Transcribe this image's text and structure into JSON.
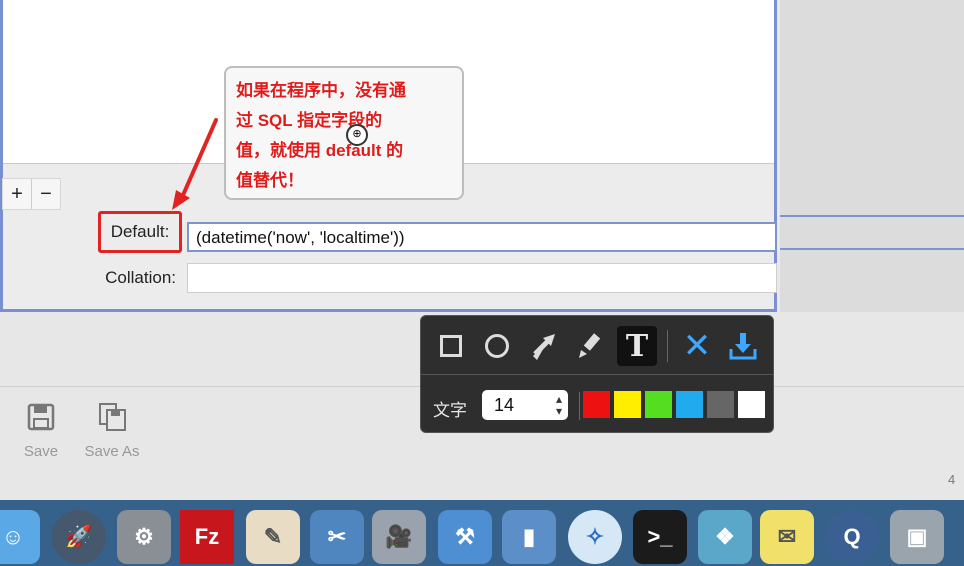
{
  "form": {
    "add_label": "+",
    "remove_label": "−",
    "default_label": "Default:",
    "default_value": "(datetime('now', 'localtime'))",
    "collation_label": "Collation:",
    "collation_value": ""
  },
  "callout": {
    "lines": [
      "如果在程序中，没有通",
      "过 SQL 指定字段的",
      "值，就使用 default 的",
      "值替代！"
    ],
    "color": "#e01b1b"
  },
  "toolbar": {
    "save_label": "Save",
    "save_as_label": "Save As"
  },
  "annotation_toolbar": {
    "text_label": "文字",
    "font_size": "14",
    "tools": [
      "rectangle-icon",
      "circle-icon",
      "arrow-icon",
      "brush-icon",
      "text-icon",
      "close-icon",
      "download-icon"
    ],
    "colors": [
      "#ee1111",
      "#ffee00",
      "#55dd22",
      "#22aaee",
      "#666666",
      "#ffffff"
    ]
  },
  "dock": {
    "apps": [
      "finder-icon",
      "launchpad-icon",
      "system-preferences-icon",
      "filezilla-icon",
      "textedit-icon",
      "screenshot-icon",
      "photo-booth-icon",
      "xcode-icon",
      "simulator-icon",
      "safari-icon",
      "terminal-icon",
      "mindnode-icon",
      "stickies-icon",
      "quicktime-icon",
      "preview-icon"
    ],
    "filezilla_text": "Fz"
  },
  "corner_number": "4"
}
